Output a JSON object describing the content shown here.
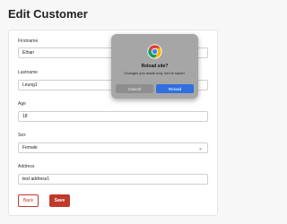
{
  "page": {
    "title": "Edit Customer"
  },
  "form": {
    "firstname_label": "Firstname",
    "firstname_value": "Ethan",
    "lastname_label": "Lastname",
    "lastname_value": "Leung1",
    "age_label": "Age",
    "age_value": "18",
    "sex_label": "Sex",
    "sex_value": "Female",
    "address_label": "Address",
    "address_value": "test address1",
    "back_label": "Back",
    "save_label": "Save"
  },
  "dialog": {
    "icon": "chrome-icon",
    "title": "Reload site?",
    "message": "Changes you made may not be saved.",
    "cancel_label": "Cancel",
    "reload_label": "Reload"
  },
  "colors": {
    "accent": "#c0392b",
    "dialog_bg": "#a6a6a6",
    "reload_button": "#2f6fe0"
  }
}
